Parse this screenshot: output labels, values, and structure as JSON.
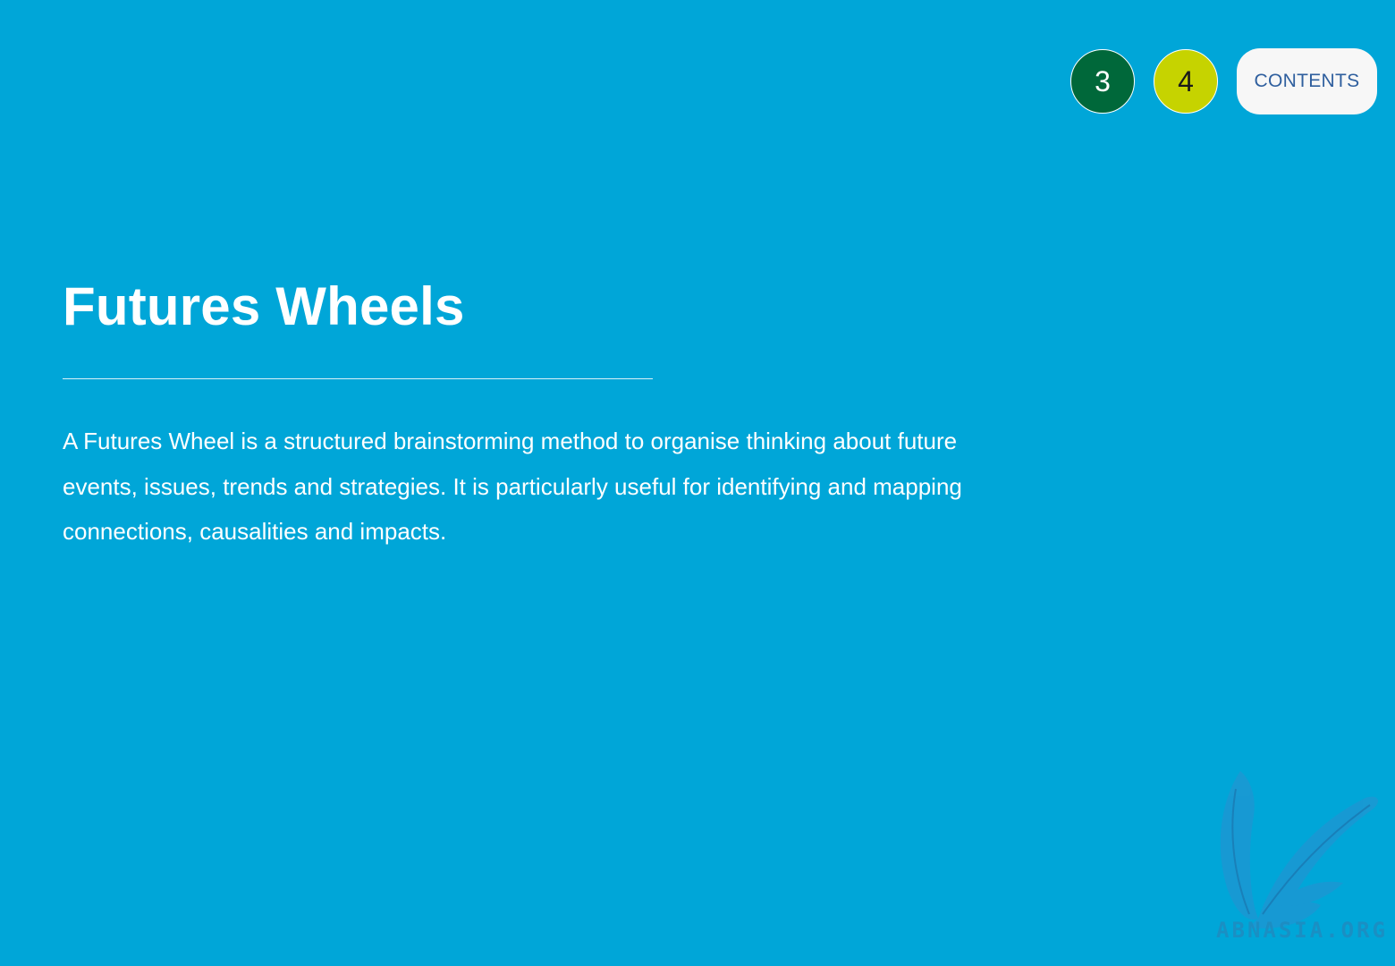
{
  "nav": {
    "section_3_label": "3",
    "section_4_label": "4",
    "contents_label": "CONTENTS"
  },
  "page": {
    "title": "Futures Wheels",
    "intro": "A Futures Wheel is a structured brainstorming method to organise thinking about future events, issues, trends and strategies. It is particularly useful for identifying and mapping connections, causalities and impacts."
  },
  "watermark": {
    "icon": "quill-icon",
    "text": "ABNASIA.ORG"
  },
  "colors": {
    "background": "#00a6d8",
    "section_3": "#00683a",
    "section_4": "#c6d300",
    "contents_text": "#2f5f9e"
  }
}
